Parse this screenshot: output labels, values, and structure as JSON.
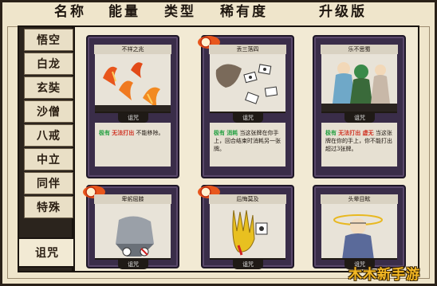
{
  "header": {
    "name": "名称",
    "energy": "能量",
    "type": "类型",
    "rarity": "稀有度",
    "upgrade": "升级版"
  },
  "sidebar": {
    "items": [
      {
        "label": "悟空"
      },
      {
        "label": "白龙"
      },
      {
        "label": "玄奘"
      },
      {
        "label": "沙僧"
      },
      {
        "label": "八戒"
      },
      {
        "label": "中立"
      },
      {
        "label": "同伴"
      },
      {
        "label": "特殊"
      },
      {
        "label": "诅咒"
      }
    ],
    "active": "诅咒"
  },
  "cards": [
    {
      "name": "不祥之兆",
      "type": "诅咒",
      "kw": "极有",
      "kw2": "无法打出",
      "text": "不能移除。"
    },
    {
      "name": "丢三落四",
      "type": "诅咒",
      "kw": "极有",
      "kw2": "消耗",
      "text": "当这张牌在你手上，回合结束时消耗另一张牌。"
    },
    {
      "name": "乐不思蜀",
      "type": "诅咒",
      "kw": "极有",
      "kw2": "无法打出 虚无",
      "text": "当这张牌在你的手上，你不能打出超过3张牌。"
    },
    {
      "name": "卑躬屈膝",
      "type": "诅咒"
    },
    {
      "name": "后悔莫及",
      "type": "诅咒"
    },
    {
      "name": "头晕目眩",
      "type": "诅咒"
    }
  ],
  "watermark": "木木新手游",
  "colors": {
    "card_frame": "#3a2d49",
    "keyword_green": "#22a040",
    "keyword_red": "#d03020",
    "watermark": "#f4b824"
  }
}
